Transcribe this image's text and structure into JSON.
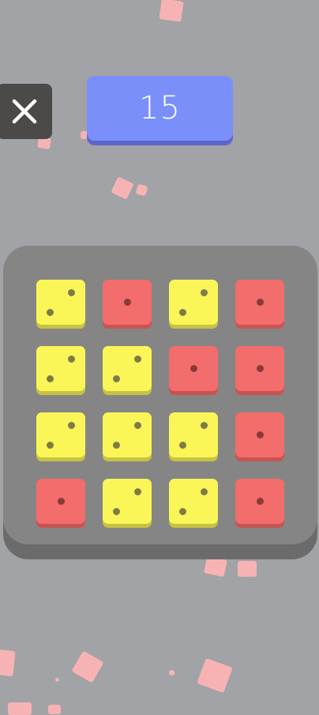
{
  "game": {
    "score": "15",
    "close_icon": "close-icon",
    "colors": {
      "background": "#a1a3a6",
      "score_panel": "#7b8ffb",
      "board": "#858585",
      "die_yellow": "#faf658",
      "die_red": "#f26d6b",
      "close_button": "#4c4a48",
      "confetti": "#f7b3b3"
    },
    "board": {
      "rows": 4,
      "cols": 4,
      "dice": [
        [
          "yellow-2",
          "red-1",
          "yellow-2",
          "red-1"
        ],
        [
          "yellow-2",
          "yellow-2",
          "red-1",
          "red-1"
        ],
        [
          "yellow-2",
          "yellow-2",
          "yellow-2",
          "red-1"
        ],
        [
          "red-1",
          "yellow-2",
          "yellow-2",
          "red-1"
        ]
      ]
    }
  }
}
